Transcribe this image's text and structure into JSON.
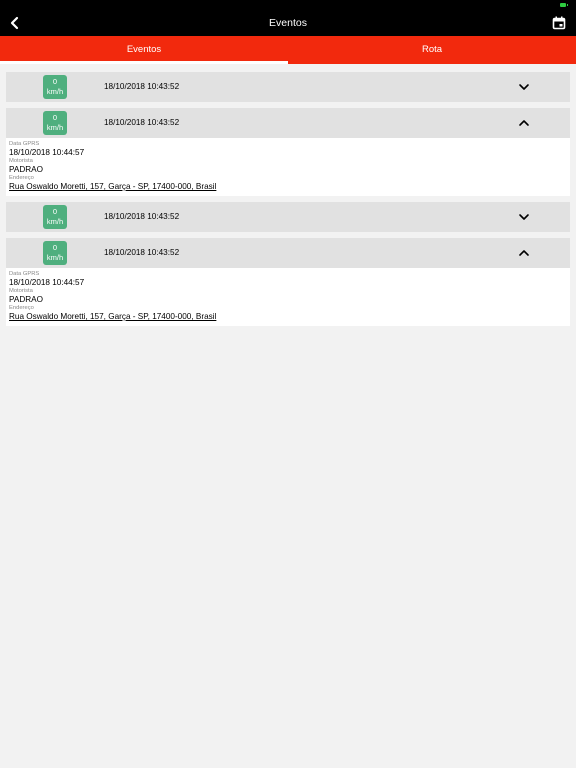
{
  "header": {
    "title": "Eventos"
  },
  "tabs": [
    {
      "label": "Eventos",
      "active": true
    },
    {
      "label": "Rota",
      "active": false
    }
  ],
  "events": [
    {
      "speed_value": "0",
      "speed_unit": "km/h",
      "datetime": "18/10/2018 10:43:52",
      "expanded": false
    },
    {
      "speed_value": "0",
      "speed_unit": "km/h",
      "datetime": "18/10/2018 10:43:52",
      "expanded": true,
      "details": {
        "gprs_label": "Data GPRS",
        "gprs_value": "18/10/2018 10:44:57",
        "driver_label": "Motorista",
        "driver_value": "PADRAO",
        "address_label": "Endereço",
        "address_value": "Rua Oswaldo Moretti, 157, Garça - SP, 17400-000, Brasil"
      }
    },
    {
      "speed_value": "0",
      "speed_unit": "km/h",
      "datetime": "18/10/2018 10:43:52",
      "expanded": false
    },
    {
      "speed_value": "0",
      "speed_unit": "km/h",
      "datetime": "18/10/2018 10:43:52",
      "expanded": true,
      "details": {
        "gprs_label": "Data GPRS",
        "gprs_value": "18/10/2018 10:44:57",
        "driver_label": "Motorista",
        "driver_value": "PADRAO",
        "address_label": "Endereço",
        "address_value": "Rua Oswaldo Moretti, 157, Garça - SP, 17400-000, Brasil"
      }
    }
  ],
  "colors": {
    "tab_bar": "#f2290d",
    "speed_badge": "#4faf7e",
    "nav_bar": "#000000"
  },
  "icons": {
    "back": "back-chevron-icon",
    "calendar": "calendar-icon",
    "collapsed": "chevron-down-icon",
    "expanded": "chevron-up-icon"
  }
}
